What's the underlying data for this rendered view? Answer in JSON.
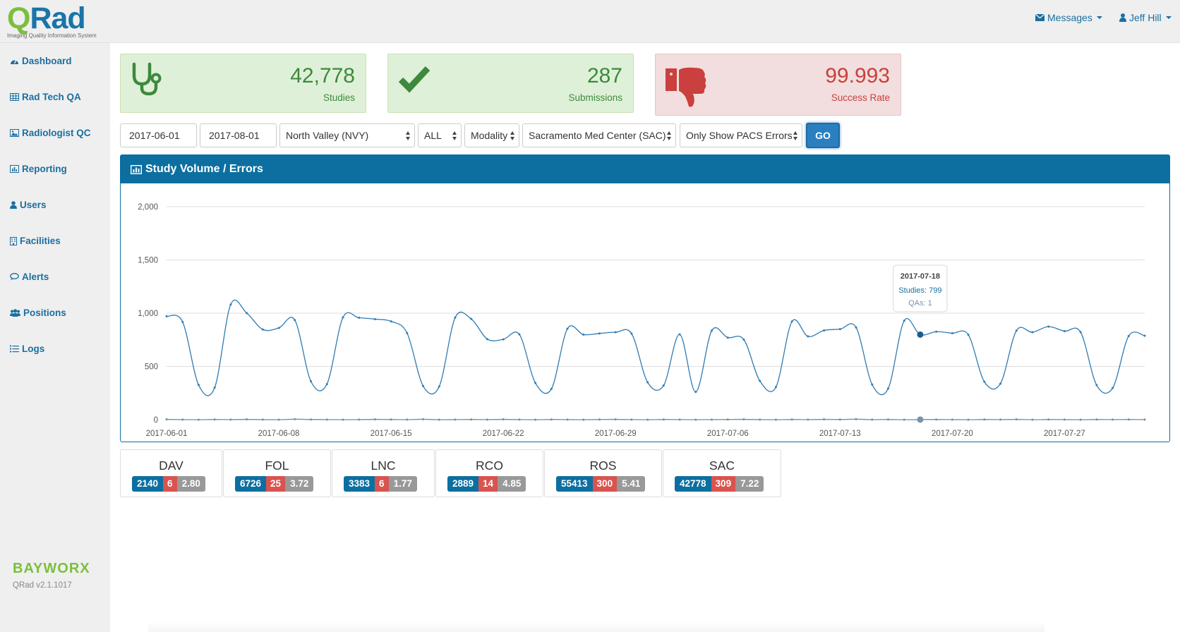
{
  "app": {
    "logo_q": "Q",
    "logo_rad": "Rad",
    "logo_tagline": "Imaging Quality Information System",
    "vendor": "BAYWORX",
    "version": "QRad v2.1.1017"
  },
  "topnav": {
    "messages_label": "Messages",
    "user_label": "Jeff Hill"
  },
  "sidebar": {
    "items": [
      {
        "label": "Dashboard",
        "icon": "dashboard-icon"
      },
      {
        "label": "Rad Tech QA",
        "icon": "table-icon"
      },
      {
        "label": "Radiologist QC",
        "icon": "image-icon"
      },
      {
        "label": "Reporting",
        "icon": "bar-chart-icon"
      },
      {
        "label": "Users",
        "icon": "user-icon"
      },
      {
        "label": "Facilities",
        "icon": "building-icon"
      },
      {
        "label": "Alerts",
        "icon": "comment-icon"
      },
      {
        "label": "Positions",
        "icon": "users-icon"
      },
      {
        "label": "Logs",
        "icon": "list-icon"
      }
    ]
  },
  "stats": {
    "studies": {
      "value": "42,778",
      "label": "Studies",
      "icon": "stethoscope-icon"
    },
    "submissions": {
      "value": "287",
      "label": "Submissions",
      "icon": "check-icon"
    },
    "success": {
      "value": "99.993",
      "label": "Success Rate",
      "icon": "thumbs-down-icon"
    }
  },
  "filters": {
    "start_date": "2017-06-01",
    "end_date": "2017-08-01",
    "region": "North Valley (NVY)",
    "scope": "ALL",
    "modality": "Modality",
    "facility": "Sacramento Med Center (SAC)",
    "error_filter": "Only Show PACS Errors",
    "go_label": "GO"
  },
  "panel": {
    "title": "Study Volume / Errors"
  },
  "tooltip": {
    "date": "2017-07-18",
    "studies": "Studies: 799",
    "qas": "QAs: 1"
  },
  "colors": {
    "primary": "#0c6fa0",
    "success_bg": "#dff0d8",
    "danger_bg": "#f2dede",
    "line": "#2f7bb2",
    "danger": "#d9534f"
  },
  "chart_data": {
    "type": "line",
    "start_date": "2017-06-01",
    "ylim": [
      0,
      2000
    ],
    "y_ticks": [
      "0",
      "500",
      "1,000",
      "1,500",
      "2,000"
    ],
    "x_ticks": [
      "2017-06-01",
      "2017-06-08",
      "2017-06-15",
      "2017-06-22",
      "2017-06-29",
      "2017-07-06",
      "2017-07-13",
      "2017-07-20",
      "2017-07-27"
    ],
    "series": [
      {
        "values": [
          971,
          918,
          326,
          301,
          1081,
          1001,
          847,
          861,
          935,
          361,
          334,
          960,
          957,
          944,
          923,
          813,
          316,
          311,
          959,
          946,
          757,
          754,
          801,
          345,
          289,
          854,
          799,
          810,
          821,
          808,
          351,
          321,
          801,
          261,
          836,
          771,
          752,
          364,
          306,
          921,
          782,
          838,
          850,
          866,
          330,
          292,
          929,
          799,
          826,
          812,
          797,
          356,
          338,
          836,
          821,
          874,
          831,
          822,
          325,
          297,
          786,
          788
        ]
      },
      {
        "values": [
          3,
          1,
          0,
          2,
          1,
          3,
          1,
          0,
          5,
          2,
          1,
          0,
          1,
          3,
          2,
          1,
          4,
          0,
          1,
          2,
          1,
          3,
          1,
          0,
          2,
          1,
          0,
          2,
          3,
          1,
          0,
          2,
          1,
          0,
          1,
          2,
          3,
          1,
          0,
          2,
          1,
          3,
          2,
          5,
          1,
          2,
          0,
          1,
          2,
          1,
          0,
          2,
          1,
          3,
          0,
          2,
          1,
          0,
          2,
          1,
          2,
          1
        ]
      }
    ]
  },
  "sites": [
    {
      "code": "DAV",
      "studies": "2140",
      "errors": "6",
      "rate": "2.80"
    },
    {
      "code": "FOL",
      "studies": "6726",
      "errors": "25",
      "rate": "3.72"
    },
    {
      "code": "LNC",
      "studies": "3383",
      "errors": "6",
      "rate": "1.77"
    },
    {
      "code": "RCO",
      "studies": "2889",
      "errors": "14",
      "rate": "4.85"
    },
    {
      "code": "ROS",
      "studies": "55413",
      "errors": "300",
      "rate": "5.41"
    },
    {
      "code": "SAC",
      "studies": "42778",
      "errors": "309",
      "rate": "7.22"
    }
  ]
}
